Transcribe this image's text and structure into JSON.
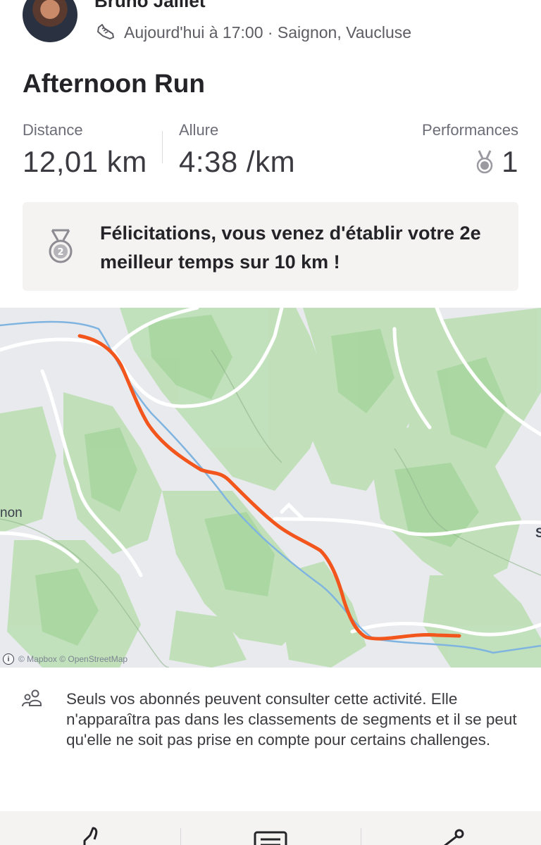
{
  "athlete": {
    "name": "Bruno Jalliet",
    "meta": "Aujourd'hui à 17:00 · Saignon, Vaucluse"
  },
  "activity": {
    "title": "Afternoon Run",
    "stats": [
      {
        "label": "Distance",
        "value": "12,01 km"
      },
      {
        "label": "Allure",
        "value": "4:38 /km"
      },
      {
        "label": "Performances",
        "value": "1"
      }
    ]
  },
  "achievement": {
    "medal_number": "2",
    "message": "Félicitations, vous venez d'établir votre 2e meilleur temps sur 10 km !"
  },
  "map": {
    "place_label_left": "non",
    "place_label_right": "S",
    "attribution": "© Mapbox © OpenStreetMap",
    "route_color": "#f2561d"
  },
  "privacy": {
    "text": "Seuls vos abonnés peuvent consulter cette activité. Elle n'apparaîtra pas dans les classements de segments et il se peut qu'elle ne soit pas prise en compte pour certains challenges."
  },
  "toolbar": {
    "icons": [
      "thumbs-up-icon",
      "comment-icon",
      "share-icon"
    ]
  },
  "colors": {
    "brand": "#f2561d",
    "banner_bg": "#f4f3f1",
    "text": "#242428"
  }
}
